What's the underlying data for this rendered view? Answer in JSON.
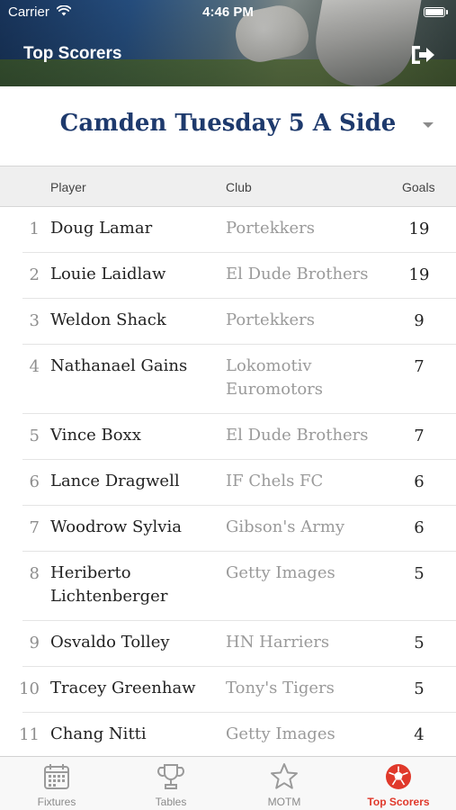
{
  "status_bar": {
    "carrier": "Carrier",
    "time": "4:46 PM"
  },
  "nav": {
    "title": "Top Scorers",
    "logout_icon": "logout-icon"
  },
  "league": {
    "name": "Camden Tuesday 5 A Side"
  },
  "table": {
    "headers": {
      "player": "Player",
      "club": "Club",
      "goals": "Goals"
    },
    "rows": [
      {
        "rank": "1",
        "player": "Doug Lamar",
        "club": "Portekkers",
        "goals": "19"
      },
      {
        "rank": "2",
        "player": "Louie Laidlaw",
        "club": "El Dude Brothers",
        "goals": "19"
      },
      {
        "rank": "3",
        "player": "Weldon Shack",
        "club": "Portekkers",
        "goals": "9"
      },
      {
        "rank": "4",
        "player": "Nathanael Gains",
        "club": "Lokomotiv Euromotors",
        "goals": "7"
      },
      {
        "rank": "5",
        "player": "Vince Boxx",
        "club": "El Dude Brothers",
        "goals": "7"
      },
      {
        "rank": "6",
        "player": "Lance Dragwell",
        "club": "IF Chels FC",
        "goals": "6"
      },
      {
        "rank": "7",
        "player": "Woodrow Sylvia",
        "club": "Gibson's Army",
        "goals": "6"
      },
      {
        "rank": "8",
        "player": "Heriberto Lichtenberger",
        "club": "Getty Images",
        "goals": "5"
      },
      {
        "rank": "9",
        "player": "Osvaldo Tolley",
        "club": "HN Harriers",
        "goals": "5"
      },
      {
        "rank": "10",
        "player": "Tracey Greenhaw",
        "club": "Tony's Tigers",
        "goals": "5"
      },
      {
        "rank": "11",
        "player": "Chang Nitti",
        "club": "Getty Images",
        "goals": "4"
      }
    ]
  },
  "tabs": [
    {
      "label": "Fixtures",
      "icon": "calendar-icon",
      "active": false
    },
    {
      "label": "Tables",
      "icon": "trophy-icon",
      "active": false
    },
    {
      "label": "MOTM",
      "icon": "star-icon",
      "active": false
    },
    {
      "label": "Top Scorers",
      "icon": "football-icon",
      "active": true
    }
  ],
  "colors": {
    "accent": "#e0392b",
    "league_title": "#1e3a6d",
    "inactive_tab": "#8a8a8a"
  }
}
